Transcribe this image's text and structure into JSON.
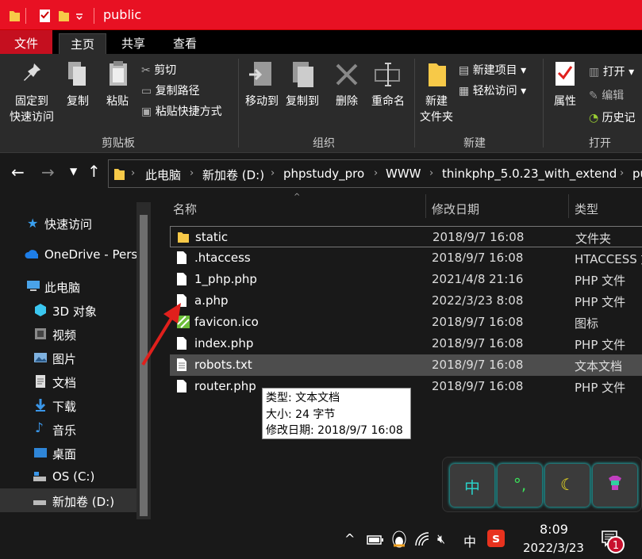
{
  "window": {
    "title": "public"
  },
  "ribbon_tabs": [
    "文件",
    "主页",
    "共享",
    "查看"
  ],
  "ribbon": {
    "pin_label": [
      "固定到",
      "快速访问"
    ],
    "copy": "复制",
    "paste": "粘贴",
    "cut": "剪切",
    "copy_path": "复制路径",
    "paste_shortcut": "粘贴快捷方式",
    "clipboard_group": "剪贴板",
    "move_to": "移动到",
    "copy_to": "复制到",
    "delete": "删除",
    "rename": "重命名",
    "organize_group": "组织",
    "new_folder": [
      "新建",
      "文件夹"
    ],
    "new_item": "新建项目",
    "easy_access": "轻松访问",
    "new_group": "新建",
    "properties": "属性",
    "open": "打开",
    "edit": "编辑",
    "history": "历史记",
    "open_group": "打开"
  },
  "breadcrumb": [
    "此电脑",
    "新加卷 (D:)",
    "phpstudy_pro",
    "WWW",
    "thinkphp_5.0.23_with_extend",
    "pu"
  ],
  "sidebar": [
    {
      "label": "快速访问",
      "icon": "star-icon"
    },
    {
      "label": "OneDrive - Perso",
      "icon": "cloud-icon"
    },
    {
      "label": "此电脑",
      "icon": "computer-icon"
    },
    {
      "label": "3D 对象",
      "icon": "cube-icon"
    },
    {
      "label": "视频",
      "icon": "video-icon"
    },
    {
      "label": "图片",
      "icon": "picture-icon"
    },
    {
      "label": "文档",
      "icon": "document-icon"
    },
    {
      "label": "下载",
      "icon": "download-icon"
    },
    {
      "label": "音乐",
      "icon": "music-icon"
    },
    {
      "label": "桌面",
      "icon": "desktop-icon"
    },
    {
      "label": "OS (C:)",
      "icon": "drive-icon"
    },
    {
      "label": "新加卷 (D:)",
      "icon": "drive-icon"
    }
  ],
  "columns": {
    "name": "名称",
    "modified": "修改日期",
    "type": "类型"
  },
  "files": [
    {
      "name": "static",
      "modified": "2018/9/7 16:08",
      "type": "文件夹",
      "icon": "folder-icon"
    },
    {
      "name": ".htaccess",
      "modified": "2018/9/7 16:08",
      "type": "HTACCESS 文",
      "icon": "file-icon"
    },
    {
      "name": "1_php.php",
      "modified": "2021/4/8 21:16",
      "type": "PHP 文件",
      "icon": "file-icon"
    },
    {
      "name": "a.php",
      "modified": "2022/3/23 8:08",
      "type": "PHP 文件",
      "icon": "file-icon"
    },
    {
      "name": "favicon.ico",
      "modified": "2018/9/7 16:08",
      "type": "图标",
      "icon": "image-icon"
    },
    {
      "name": "index.php",
      "modified": "2018/9/7 16:08",
      "type": "PHP 文件",
      "icon": "file-icon"
    },
    {
      "name": "robots.txt",
      "modified": "2018/9/7 16:08",
      "type": "文本文档",
      "icon": "text-file-icon"
    },
    {
      "name": "router.php",
      "modified": "2018/9/7 16:08",
      "type": "PHP 文件",
      "icon": "file-icon"
    }
  ],
  "tooltip": [
    "类型: 文本文档",
    "大小: 24 字节",
    "修改日期: 2018/9/7 16:08"
  ],
  "ime": {
    "keys": [
      "中",
      "°,",
      "moon-icon",
      "shirt-icon"
    ]
  },
  "taskbar": {
    "ime_mode": "中",
    "time": "8:09",
    "date": "2022/3/23",
    "notifications": "1"
  },
  "colors": {
    "titlebar": "#e81123",
    "file_tab": "#c50f1f",
    "annotation_arrow": "#e0201c"
  }
}
